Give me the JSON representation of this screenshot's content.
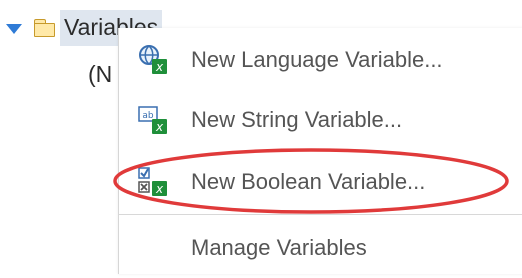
{
  "tree": {
    "folder_label": "Variables",
    "child_label": "(N"
  },
  "context_menu": {
    "items": [
      {
        "label": "New Language Variable...",
        "icon": "globe-variable-icon"
      },
      {
        "label": "New String Variable...",
        "icon": "string-variable-icon"
      },
      {
        "label": "New Boolean Variable...",
        "icon": "boolean-variable-icon"
      },
      {
        "label": "Manage Variables",
        "icon": ""
      }
    ]
  },
  "colors": {
    "caret": "#2f7bd6",
    "selection": "#dfe6ef",
    "highlight_ellipse": "#e03a3a",
    "excel_green": "#1f8f3a"
  }
}
